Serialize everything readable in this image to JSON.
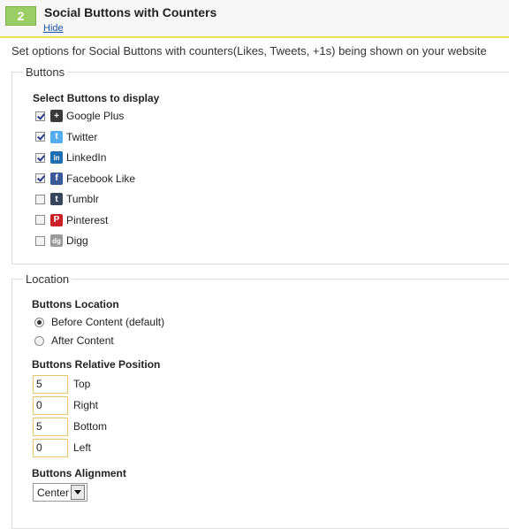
{
  "section": {
    "step": "2",
    "title": "Social Buttons with Counters",
    "hide_label": "Hide",
    "description": "Set options for Social Buttons with counters(Likes, Tweets, +1s) being shown on your website"
  },
  "buttons_box": {
    "legend": "Buttons",
    "subheading": "Select Buttons to display",
    "items": [
      {
        "label": "Google Plus",
        "checked": true,
        "icon": "google-plus-icon",
        "color": "#3a3a3a"
      },
      {
        "label": "Twitter",
        "checked": true,
        "icon": "twitter-icon",
        "color": "#55acee"
      },
      {
        "label": "LinkedIn",
        "checked": true,
        "icon": "linkedin-icon",
        "color": "#1f6db3"
      },
      {
        "label": "Facebook Like",
        "checked": true,
        "icon": "facebook-icon",
        "color": "#3b5998"
      },
      {
        "label": "Tumblr",
        "checked": false,
        "icon": "tumblr-icon",
        "color": "#35465c"
      },
      {
        "label": "Pinterest",
        "checked": false,
        "icon": "pinterest-icon",
        "color": "#cb2027"
      },
      {
        "label": "Digg",
        "checked": false,
        "icon": "digg-icon",
        "color": "#9a9a9a"
      }
    ]
  },
  "location_box": {
    "legend": "Location",
    "location_heading": "Buttons Location",
    "location_options": [
      {
        "label": "Before Content (default)",
        "selected": true
      },
      {
        "label": "After Content",
        "selected": false
      }
    ],
    "position_heading": "Buttons Relative Position",
    "positions": [
      {
        "value": "5",
        "label": "Top"
      },
      {
        "value": "0",
        "label": "Right"
      },
      {
        "value": "5",
        "label": "Bottom"
      },
      {
        "value": "0",
        "label": "Left"
      }
    ],
    "alignment_heading": "Buttons Alignment",
    "alignment_value": "Center"
  }
}
